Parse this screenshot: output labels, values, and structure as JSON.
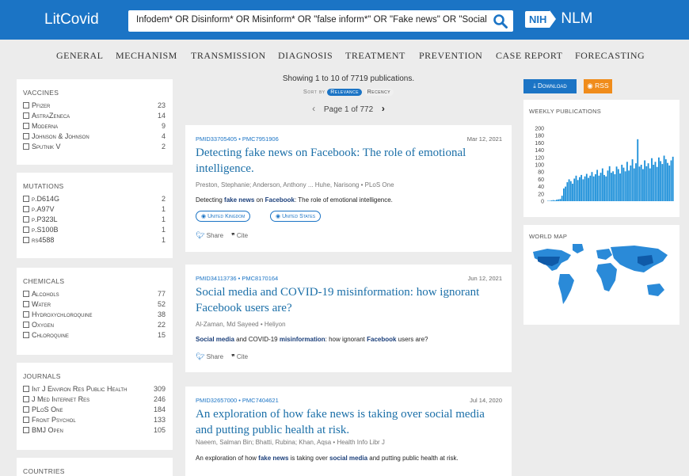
{
  "header": {
    "logo": "LitCovid",
    "search_query": "Infodem* OR Disinform* OR Misinform* OR \"false inform*\" OR \"Fake news\" OR \"Social media\"",
    "nih": "NIH",
    "nlm": "NLM",
    "colors": {
      "bar": "#1b74c5",
      "accent": "#f08c1b"
    }
  },
  "nav": [
    "GENERAL",
    "MECHANISM",
    "TRANSMISSION",
    "DIAGNOSIS",
    "TREATMENT",
    "PREVENTION",
    "CASE REPORT",
    "FORECASTING"
  ],
  "facets": [
    {
      "title": "VACCINES",
      "items": [
        {
          "label": "Pfizer",
          "count": "23"
        },
        {
          "label": "AstraZeneca",
          "count": "14"
        },
        {
          "label": "Moderna",
          "count": "9"
        },
        {
          "label": "Johnson & Johnson",
          "count": "4"
        },
        {
          "label": "Sputnik V",
          "count": "2"
        }
      ]
    },
    {
      "title": "MUTATIONS",
      "items": [
        {
          "label": "p.D614G",
          "count": "2"
        },
        {
          "label": "p.A97V",
          "count": "1"
        },
        {
          "label": "p.P323L",
          "count": "1"
        },
        {
          "label": "p.S100B",
          "count": "1"
        },
        {
          "label": "rs4588",
          "count": "1"
        }
      ]
    },
    {
      "title": "CHEMICALS",
      "items": [
        {
          "label": "Alcohols",
          "count": "77"
        },
        {
          "label": "Water",
          "count": "52"
        },
        {
          "label": "Hydroxychloroquine",
          "count": "38"
        },
        {
          "label": "Oxygen",
          "count": "22"
        },
        {
          "label": "Chloroquine",
          "count": "15"
        }
      ]
    },
    {
      "title": "JOURNALS",
      "items": [
        {
          "label": "Int J Environ Res Public Health",
          "count": "309"
        },
        {
          "label": "J Med Internet Res",
          "count": "246"
        },
        {
          "label": "PLoS One",
          "count": "184"
        },
        {
          "label": "Front Psychol",
          "count": "133"
        },
        {
          "label": "BMJ Open",
          "count": "105"
        }
      ]
    },
    {
      "title": "COUNTRIES",
      "items": []
    }
  ],
  "results": {
    "summary": "Showing 1 to 10 of 7719 publications.",
    "sort_label": "Sort by",
    "sort_relevance": "Relevance",
    "sort_recency": "Recency",
    "page_text": "Page 1 of 772",
    "share": "Share",
    "cite": "Cite",
    "articles": [
      {
        "ids": "PMID33705405 • PMC7951906",
        "date": "Mar 12, 2021",
        "title": "Detecting fake news on Facebook: The role of emotional intelligence.",
        "authors": "Preston, Stephanie; Anderson, Anthony ... Huhe, Narisong • PLoS One",
        "snippet": [
          {
            "t": "Detecting ",
            "b": false
          },
          {
            "t": "fake news",
            "b": true
          },
          {
            "t": " on ",
            "b": false
          },
          {
            "t": "Facebook",
            "b": true
          },
          {
            "t": ": The role of emotional intelligence.",
            "b": false
          }
        ],
        "tags": [
          "United Kingdom",
          "United States"
        ]
      },
      {
        "ids": "PMID34113736 • PMC8170164",
        "date": "Jun 12, 2021",
        "title": "Social media and COVID-19 misinformation: how ignorant Facebook users are?",
        "authors": "Al-Zaman, Md Sayeed • Heliyon",
        "snippet": [
          {
            "t": "Social media",
            "b": true
          },
          {
            "t": " and COVID-19 ",
            "b": false
          },
          {
            "t": "misinformation",
            "b": true
          },
          {
            "t": ": how ignorant ",
            "b": false
          },
          {
            "t": "Facebook",
            "b": true
          },
          {
            "t": " users are?",
            "b": false
          }
        ],
        "tags": []
      },
      {
        "ids": "PMID32657000 • PMC7404621",
        "date": "Jul 14, 2020",
        "title": "An exploration of how fake news is taking over social media and putting public health at risk.",
        "authors": "Naeem, Salman Bin; Bhatti, Rubina; Khan, Aqsa • Health Info Libr J",
        "snippet": [
          {
            "t": "An exploration of how ",
            "b": false
          },
          {
            "t": "fake news",
            "b": true
          },
          {
            "t": " is taking over ",
            "b": false
          },
          {
            "t": "social media",
            "b": true
          },
          {
            "t": " and putting public health at risk.",
            "b": false
          }
        ],
        "tags": []
      }
    ]
  },
  "side": {
    "download": "Download",
    "rss": "RSS",
    "weekly_title": "WEEKLY PUBLICATIONS",
    "world_title": "WORLD MAP",
    "colors": {
      "bars": "#1b8fd9",
      "map": "#2a8ad8"
    }
  },
  "chart_data": {
    "type": "bar",
    "title": "WEEKLY PUBLICATIONS",
    "ylim": [
      0,
      200
    ],
    "y_ticks": [
      "0",
      "20",
      "40",
      "60",
      "80",
      "100",
      "120",
      "140",
      "160",
      "180",
      "200"
    ],
    "values": [
      1,
      1,
      2,
      3,
      2,
      4,
      5,
      6,
      15,
      35,
      40,
      52,
      60,
      55,
      48,
      62,
      70,
      58,
      66,
      72,
      60,
      68,
      75,
      64,
      70,
      80,
      68,
      74,
      86,
      70,
      78,
      90,
      72,
      68,
      84,
      96,
      78,
      82,
      74,
      95,
      88,
      76,
      100,
      92,
      82,
      108,
      84,
      98,
      115,
      90,
      104,
      170,
      95,
      100,
      88,
      112,
      96,
      104,
      90,
      118,
      100,
      108,
      94,
      120,
      110,
      102,
      125,
      115,
      105,
      98,
      112,
      122
    ]
  }
}
